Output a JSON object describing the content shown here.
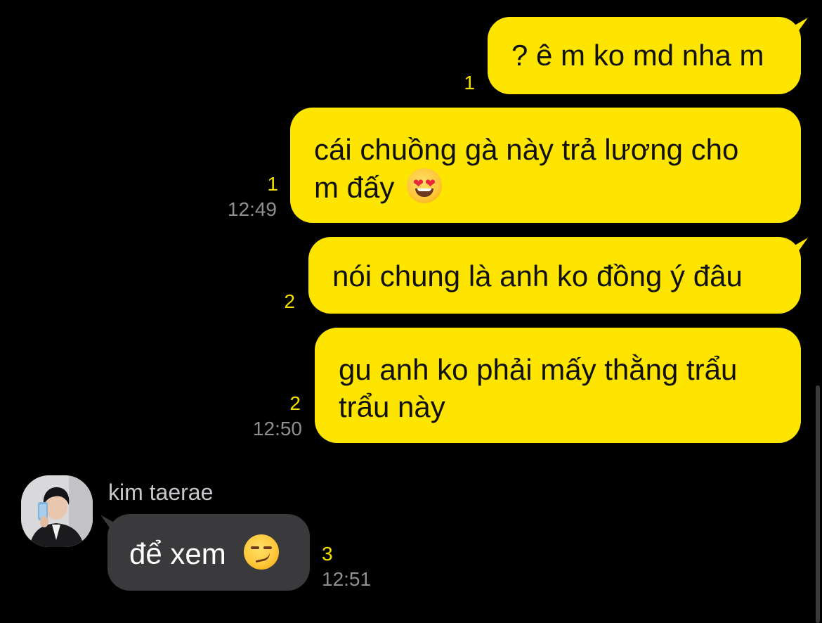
{
  "colors": {
    "background": "#000000",
    "outgoing_bubble": "#FEE500",
    "incoming_bubble": "#3A3A3C",
    "unread_count": "#F5E000",
    "timestamp": "#8E8E93"
  },
  "messages": [
    {
      "direction": "out",
      "text": "? ê m ko md nha m",
      "unread": "1",
      "time": ""
    },
    {
      "direction": "out",
      "line1": "cái chuồng gà này trả lương cho",
      "line2": "m đấy",
      "emoji": "heart-eyes-emoji",
      "unread": "1",
      "time": "12:49"
    },
    {
      "direction": "out",
      "text": "nói chung là anh ko đồng ý đâu",
      "unread": "2",
      "time": ""
    },
    {
      "direction": "out",
      "line1": "gu anh ko phải mấy thằng trẩu",
      "line2": "trẩu này",
      "unread": "2",
      "time": "12:50"
    },
    {
      "direction": "in",
      "sender": "kim taerae",
      "text": "để xem",
      "emoji": "smirk-emoji",
      "unread": "3",
      "time": "12:51"
    }
  ]
}
